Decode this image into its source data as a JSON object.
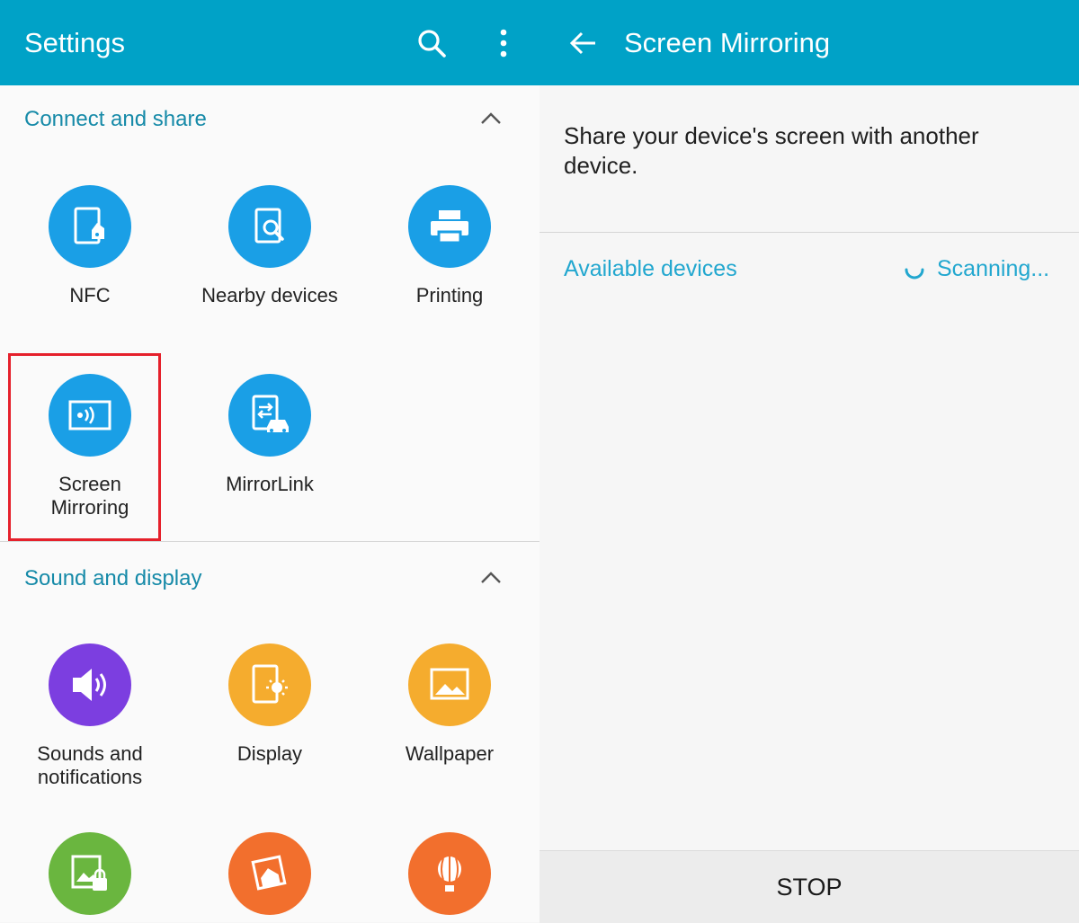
{
  "settings": {
    "title": "Settings",
    "sections": {
      "connect": {
        "title": "Connect and share"
      },
      "sound": {
        "title": "Sound and display"
      }
    },
    "tiles": {
      "nfc": "NFC",
      "nearby": "Nearby devices",
      "printing": "Printing",
      "mirroring_line1": "Screen",
      "mirroring_line2": "Mirroring",
      "mirrorlink": "MirrorLink",
      "sounds_line1": "Sounds and",
      "sounds_line2": "notifications",
      "display": "Display",
      "wallpaper": "Wallpaper"
    },
    "colors": {
      "appbar": "#00a2c7",
      "blue_icon": "#1a9fe6",
      "purple_icon": "#7c3ee0",
      "amber_icon": "#f5ac2e",
      "green_icon": "#6ab63f",
      "orange_icon": "#f26f2d",
      "highlight": "#e5202b"
    }
  },
  "mirroring": {
    "title": "Screen Mirroring",
    "description": "Share your device's screen with another device.",
    "available_label": "Available devices",
    "scanning_label": "Scanning...",
    "stop_label": "STOP"
  }
}
